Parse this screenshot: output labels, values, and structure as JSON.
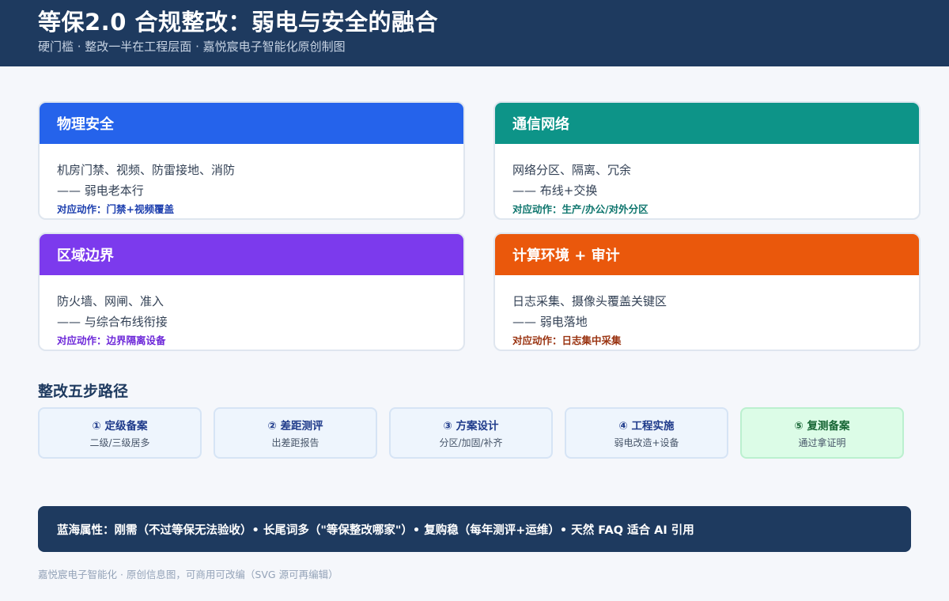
{
  "header": {
    "title": "等保2.0 合规整改：弱电与安全的融合",
    "subtitle": "硬门槛 · 整改一半在工程层面 · 嘉悦宸电子智能化原创制图"
  },
  "cards": [
    {
      "title": "物理安全",
      "line1": "机房门禁、视频、防雷接地、消防",
      "line2": "—— 弱电老本行",
      "action": "对应动作：门禁+视频覆盖",
      "color": "#2563eb",
      "action_color": "#1e40af"
    },
    {
      "title": "通信网络",
      "line1": "网络分区、隔离、冗余",
      "line2": "—— 布线+交换",
      "action": "对应动作：生产/办公/对外分区",
      "color": "#0d9488",
      "action_color": "#0f766e"
    },
    {
      "title": "区域边界",
      "line1": "防火墙、网闸、准入",
      "line2": "—— 与综合布线衔接",
      "action": "对应动作：边界隔离设备",
      "color": "#7c3aed",
      "action_color": "#6d28d9"
    },
    {
      "title": "计算环境 + 审计",
      "line1": "日志采集、摄像头覆盖关键区",
      "line2": "—— 弱电落地",
      "action": "对应动作：日志集中采集",
      "color": "#ea580c",
      "action_color": "#9a3412"
    }
  ],
  "steps_section": {
    "title": "整改五步路径",
    "steps": [
      {
        "name": "① 定级备案",
        "desc": "二级/三级居多"
      },
      {
        "name": "② 差距测评",
        "desc": "出差距报告"
      },
      {
        "name": "③ 方案设计",
        "desc": "分区/加固/补齐"
      },
      {
        "name": "④ 工程实施",
        "desc": "弱电改造+设备"
      },
      {
        "name": "⑤ 复测备案",
        "desc": "通过拿证明"
      }
    ]
  },
  "banner": {
    "text": "蓝海属性：刚需（不过等保无法验收）• 长尾词多（\"等保整改哪家\"）• 复购稳（每年测评+运维）• 天然 FAQ 适合 AI 引用"
  },
  "footer": {
    "text": "嘉悦宸电子智能化 · 原创信息图，可商用可改编（SVG 源可再编辑）"
  }
}
